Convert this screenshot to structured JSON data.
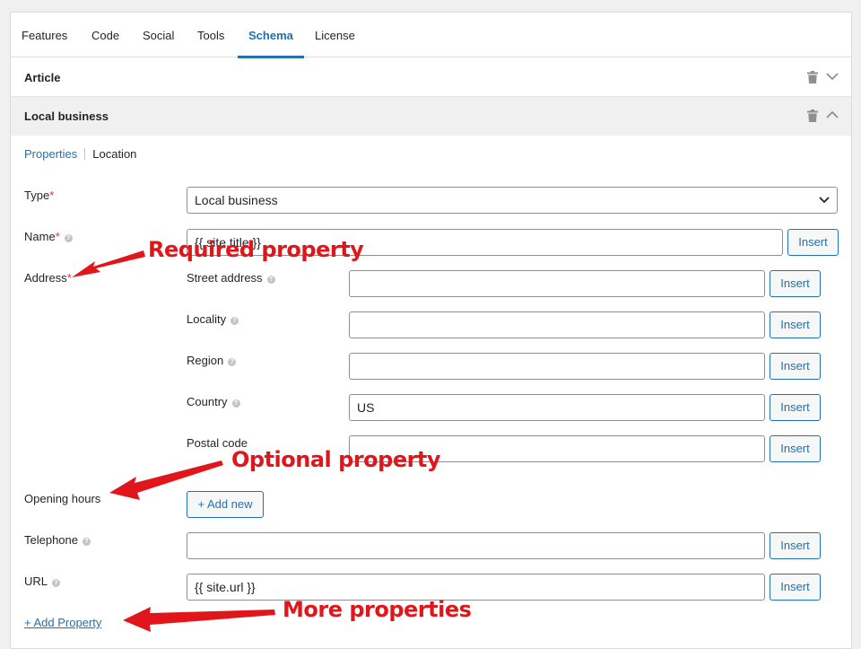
{
  "tabs": [
    "Features",
    "Code",
    "Social",
    "Tools",
    "Schema",
    "License"
  ],
  "active_tab": "Schema",
  "sections": {
    "article": {
      "title": "Article"
    },
    "local_business": {
      "title": "Local business"
    }
  },
  "subtabs": [
    "Properties",
    "Location"
  ],
  "form": {
    "type": {
      "label": "Type",
      "required": "*",
      "value": "Local business"
    },
    "name": {
      "label": "Name",
      "required": "*",
      "value": "{{ site.title }}",
      "insert": "Insert"
    },
    "address": {
      "label": "Address",
      "required": "*",
      "fields": [
        {
          "label": "Street address",
          "value": "",
          "insert": "Insert"
        },
        {
          "label": "Locality",
          "value": "",
          "insert": "Insert"
        },
        {
          "label": "Region",
          "value": "",
          "insert": "Insert"
        },
        {
          "label": "Country",
          "value": "US",
          "insert": "Insert"
        },
        {
          "label": "Postal code",
          "value": "",
          "insert": "Insert"
        }
      ]
    },
    "opening_hours": {
      "label": "Opening hours",
      "add": "+ Add new"
    },
    "telephone": {
      "label": "Telephone",
      "value": "",
      "insert": "Insert"
    },
    "url": {
      "label": "URL",
      "value": "{{ site.url }}",
      "insert": "Insert"
    },
    "add_property": "+ Add Property"
  },
  "annotations": {
    "required": "Required property",
    "optional": "Optional property",
    "more": "More properties"
  },
  "colors": {
    "accent": "#2271b1",
    "required": "#d63638",
    "annotation": "#e0161b"
  }
}
